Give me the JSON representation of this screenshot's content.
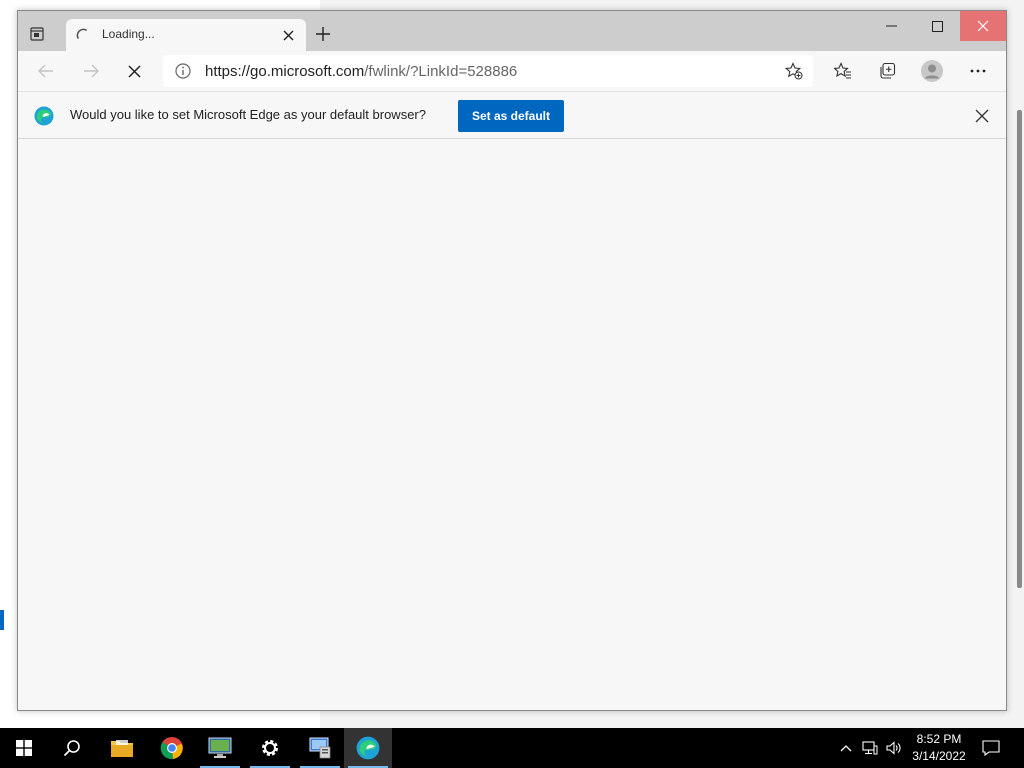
{
  "browser": {
    "tab": {
      "title": "Loading..."
    },
    "address": {
      "domain": "https://go.microsoft.com",
      "path": "/fwlink/?LinkId=528886"
    },
    "icons": {
      "tab_actions": "tab-actions-icon",
      "loading": "loading-spinner-icon",
      "tab_close": "close-icon",
      "new_tab": "plus-icon",
      "back": "back-arrow-icon",
      "forward": "forward-arrow-icon",
      "stop": "stop-loading-icon",
      "info": "info-icon",
      "add_favorite": "add-favorite-icon",
      "favorites": "favorites-icon",
      "collections": "collections-icon",
      "profile": "profile-icon",
      "menu": "more-icon"
    }
  },
  "infobar": {
    "message": "Would you like to set Microsoft Edge as your default browser?",
    "button_label": "Set as default"
  },
  "taskbar": {
    "items": [
      "start",
      "search",
      "file-explorer",
      "chrome",
      "remote-desktop",
      "settings",
      "server-manager",
      "edge"
    ],
    "time": "8:52 PM",
    "date": "3/14/2022"
  },
  "colors": {
    "accent": "#0067c0",
    "close_hover": "#e57373",
    "titlebar": "#cdcdcd",
    "taskbar": "#000000"
  }
}
